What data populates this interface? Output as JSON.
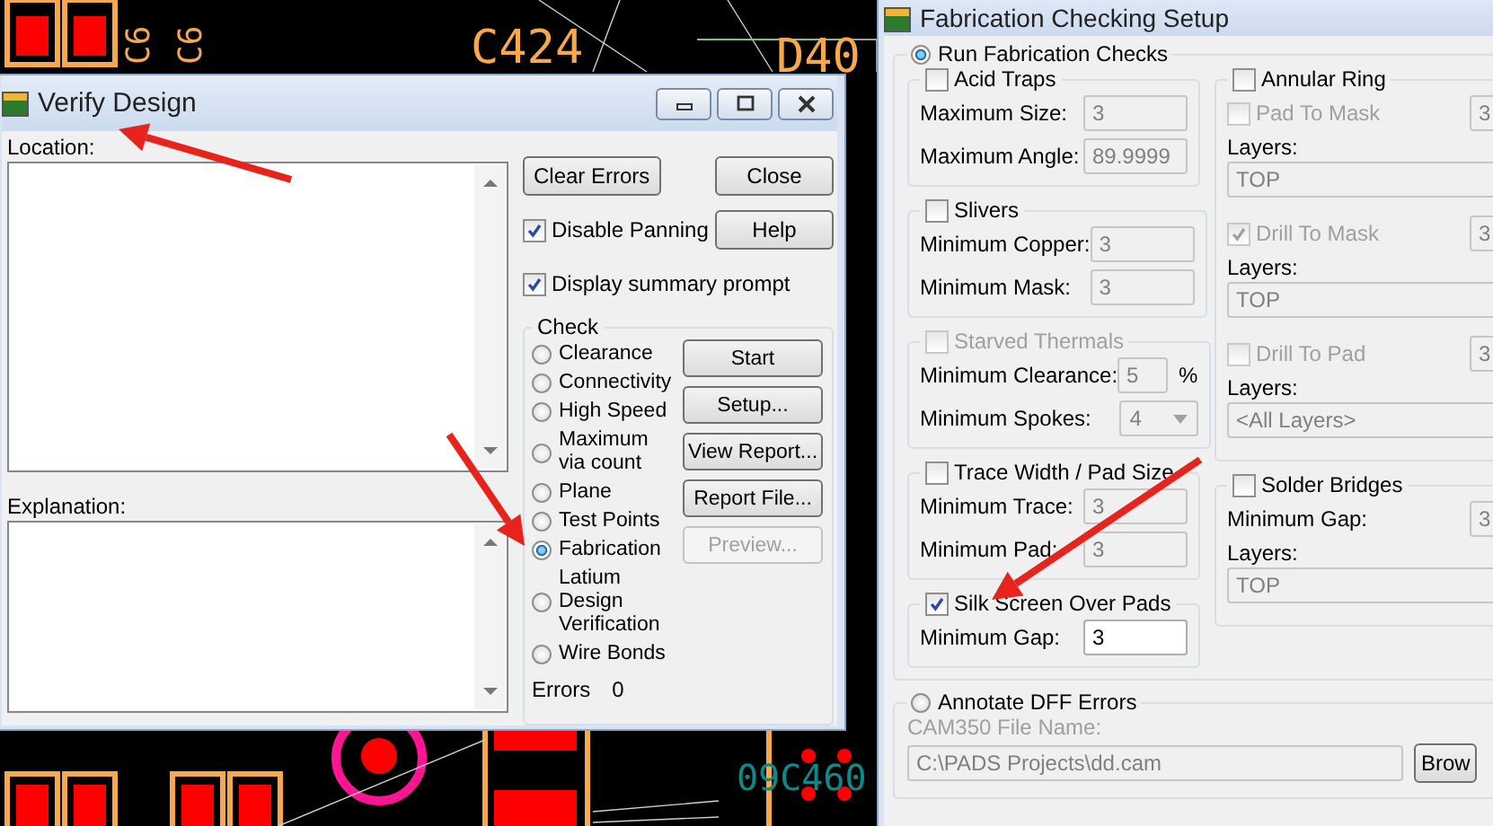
{
  "canvas": {
    "labels": [
      {
        "text": "C6",
        "kind": "vertical"
      },
      {
        "text": "C6",
        "kind": "vertical"
      },
      {
        "text": "C424",
        "kind": "large"
      },
      {
        "text": "D40",
        "kind": "large"
      },
      {
        "text": "09C460",
        "kind": "bottom"
      }
    ]
  },
  "verify_design": {
    "title": "Verify Design",
    "location_label": "Location:",
    "explanation_label": "Explanation:",
    "clear_button": "Clear Errors",
    "close_button": "Close",
    "help_button": "Help",
    "options": [
      {
        "label": "Disable Panning",
        "checked": true
      },
      {
        "label": "Display summary prompt",
        "checked": true
      }
    ],
    "check": {
      "title": "Check",
      "radios": [
        {
          "label": "Clearance",
          "selected": false
        },
        {
          "label": "Connectivity",
          "selected": false
        },
        {
          "label": "High Speed",
          "selected": false
        },
        {
          "label": "Maximum via count",
          "selected": false
        },
        {
          "label": "Plane",
          "selected": false
        },
        {
          "label": "Test Points",
          "selected": false
        },
        {
          "label": "Fabrication",
          "selected": true
        },
        {
          "label": "Latium Design Verification",
          "selected": false
        },
        {
          "label": "Wire Bonds",
          "selected": false
        }
      ],
      "buttons": [
        {
          "label": "Start",
          "disabled": false
        },
        {
          "label": "Setup...",
          "disabled": false
        },
        {
          "label": "View Report...",
          "disabled": false
        },
        {
          "label": "Report File...",
          "disabled": false
        },
        {
          "label": "Preview...",
          "disabled": true
        }
      ],
      "errors_label": "Errors",
      "errors_value": "0"
    }
  },
  "fabrication_setup": {
    "title": "Fabrication Checking Setup",
    "run_checks": {
      "label": "Run Fabrication Checks",
      "selected": true
    },
    "left_groups": [
      {
        "title": "Acid Traps",
        "checked": false,
        "disabled": false,
        "fields": [
          {
            "label": "Maximum Size:",
            "value": "3",
            "kind": "text"
          },
          {
            "label": "Maximum Angle:",
            "value": "89.9999",
            "kind": "text"
          }
        ]
      },
      {
        "title": "Slivers",
        "checked": false,
        "disabled": false,
        "fields": [
          {
            "label": "Minimum Copper:",
            "value": "3",
            "kind": "text"
          },
          {
            "label": "Minimum Mask:",
            "value": "3",
            "kind": "text"
          }
        ]
      },
      {
        "title": "Starved Thermals",
        "checked": false,
        "disabled": true,
        "fields": [
          {
            "label": "Minimum Clearance:",
            "value": "5",
            "unit": "%",
            "kind": "text"
          },
          {
            "label": "Minimum Spokes:",
            "value": "4",
            "kind": "dropdown"
          }
        ]
      },
      {
        "title": "Trace Width / Pad Size",
        "checked": false,
        "disabled": false,
        "fields": [
          {
            "label": "Minimum Trace:",
            "value": "3",
            "kind": "text"
          },
          {
            "label": "Minimum Pad:",
            "value": "3",
            "kind": "text"
          }
        ]
      },
      {
        "title": "Silk Screen Over Pads",
        "checked": true,
        "disabled": false,
        "fields": [
          {
            "label": "Minimum Gap:",
            "value": "3",
            "kind": "text"
          }
        ]
      }
    ],
    "right_groups": [
      {
        "title": "Annular Ring",
        "checked": false,
        "items": [
          {
            "kind": "check-field",
            "label": "Pad To Mask",
            "checked": false,
            "disabled": true,
            "value": "3"
          },
          {
            "kind": "label",
            "text": "Layers:"
          },
          {
            "kind": "wide-field",
            "value": "TOP",
            "disabled": true
          },
          {
            "kind": "check-field",
            "label": "Drill To Mask",
            "checked": true,
            "disabled": true,
            "value": "3"
          },
          {
            "kind": "label",
            "text": "Layers:"
          },
          {
            "kind": "wide-field",
            "value": "TOP",
            "disabled": true
          },
          {
            "kind": "check-field",
            "label": "Drill To Pad",
            "checked": false,
            "disabled": true,
            "value": "3"
          },
          {
            "kind": "label",
            "text": "Layers:"
          },
          {
            "kind": "wide-field",
            "value": "<All Layers>",
            "disabled": true
          }
        ]
      },
      {
        "title": "Solder Bridges",
        "checked": false,
        "items": [
          {
            "kind": "field",
            "label": "Minimum Gap:",
            "value": "3",
            "disabled": true
          },
          {
            "kind": "label",
            "text": "Layers:"
          },
          {
            "kind": "wide-field",
            "value": "TOP",
            "disabled": true
          }
        ]
      }
    ],
    "annotate": {
      "label": "Annotate DFF Errors",
      "selected": false,
      "file_label": "CAM350 File Name:",
      "file_value": "C:\\PADS Projects\\dd.cam",
      "browse_button": "Brow"
    }
  }
}
